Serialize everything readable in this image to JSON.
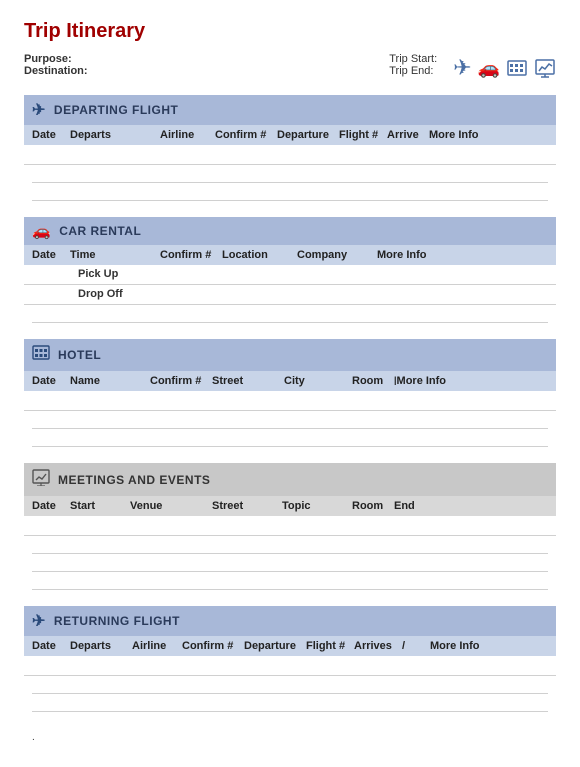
{
  "title": "Trip Itinerary",
  "header": {
    "purpose_label": "Purpose:",
    "destination_label": "Destination:",
    "trip_start_label": "Trip Start:",
    "trip_end_label": "Trip End:"
  },
  "icons": {
    "plane": "✈",
    "car": "🚗",
    "hotel": "🏢",
    "chart": "📊"
  },
  "sections": {
    "departing_flight": {
      "title": "DEPARTING FLIGHT",
      "columns": [
        "Date",
        "Departs",
        "Airline",
        "Confirm #",
        "Departure",
        "Flight #",
        "Arrive",
        "More Info"
      ]
    },
    "car_rental": {
      "title": "CAR RENTAL",
      "columns": [
        "Date",
        "Time",
        "Confirm #",
        "Location",
        "Company",
        "More Info"
      ],
      "rows": [
        "Pick Up",
        "Drop Off"
      ]
    },
    "hotel": {
      "title": "HOTEL",
      "columns": [
        "Date",
        "Name",
        "Confirm #",
        "Street",
        "City",
        "Room",
        "More Info"
      ]
    },
    "meetings": {
      "title": "MEETINGS AND EVENTS",
      "columns": [
        "Date",
        "Start",
        "Venue",
        "Street",
        "Topic",
        "Room",
        "End"
      ]
    },
    "returning_flight": {
      "title": "RETURNING FLIGHT",
      "columns": [
        "Date",
        "Departs",
        "Airline",
        "Confirm #",
        "Departure",
        "Flight #",
        "Arrives",
        "/",
        "More Info"
      ]
    }
  },
  "footer_dot": "."
}
